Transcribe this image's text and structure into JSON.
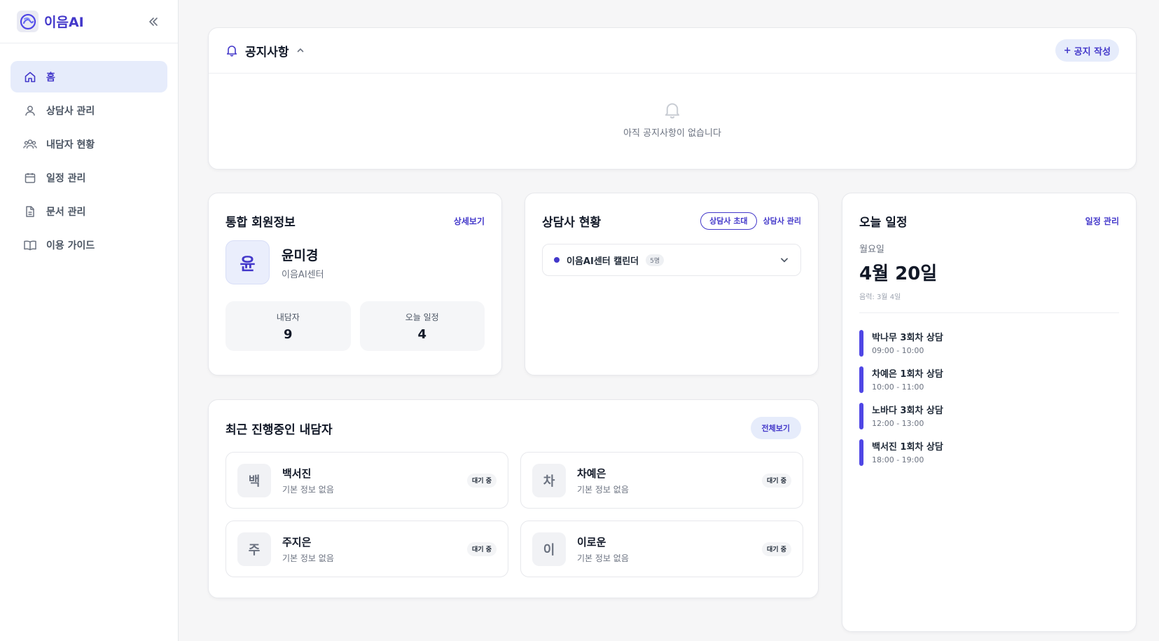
{
  "brand": {
    "name": "이음AI"
  },
  "sidebar": {
    "items": [
      {
        "label": "홈",
        "icon": "home-icon",
        "active": true
      },
      {
        "label": "상담사 관리",
        "icon": "user-icon"
      },
      {
        "label": "내담자 현황",
        "icon": "users-icon"
      },
      {
        "label": "일정 관리",
        "icon": "calendar-icon"
      },
      {
        "label": "문서 관리",
        "icon": "document-icon"
      },
      {
        "label": "이용 가이드",
        "icon": "book-icon"
      }
    ]
  },
  "notice": {
    "title": "공지사항",
    "write_label": "공지 작성",
    "empty_text": "아직 공지사항이 없습니다"
  },
  "member": {
    "title": "통합 회원정보",
    "detail_label": "상세보기",
    "avatar_initial": "윤",
    "name": "윤미경",
    "org": "이음AI센터",
    "stats": [
      {
        "label": "내담자",
        "value": "9"
      },
      {
        "label": "오늘 일정",
        "value": "4"
      }
    ]
  },
  "counselor": {
    "title": "상담사 현황",
    "invite_label": "상담사 초대",
    "manage_label": "상담사 관리",
    "center_name": "이음AI센터 캘린더",
    "center_count": "5명"
  },
  "today": {
    "title": "오늘 일정",
    "manage_label": "일정 관리",
    "weekday": "월요일",
    "date": "4월 20일",
    "lunar": "음력: 3월 4일",
    "items": [
      {
        "title": "박나무 3회차 상담",
        "time": "09:00 - 10:00"
      },
      {
        "title": "차예은 1회차 상담",
        "time": "10:00 - 11:00"
      },
      {
        "title": "노바다 3회차 상담",
        "time": "12:00 - 13:00"
      },
      {
        "title": "백서진 1회차 상담",
        "time": "18:00 - 19:00"
      }
    ]
  },
  "recent": {
    "title": "최근 진행중인 내담자",
    "all_label": "전체보기",
    "clients": [
      {
        "initial": "백",
        "name": "백서진",
        "sub": "기본 정보 없음",
        "status": "대기 중"
      },
      {
        "initial": "차",
        "name": "차예은",
        "sub": "기본 정보 없음",
        "status": "대기 중"
      },
      {
        "initial": "주",
        "name": "주지은",
        "sub": "기본 정보 없음",
        "status": "대기 중"
      },
      {
        "initial": "이",
        "name": "이로운",
        "sub": "기본 정보 없음",
        "status": "대기 중"
      }
    ]
  },
  "colors": {
    "accent": "#4338ca",
    "accent_soft": "#e6ecfb",
    "schedule_bar": "#4f46e5"
  }
}
